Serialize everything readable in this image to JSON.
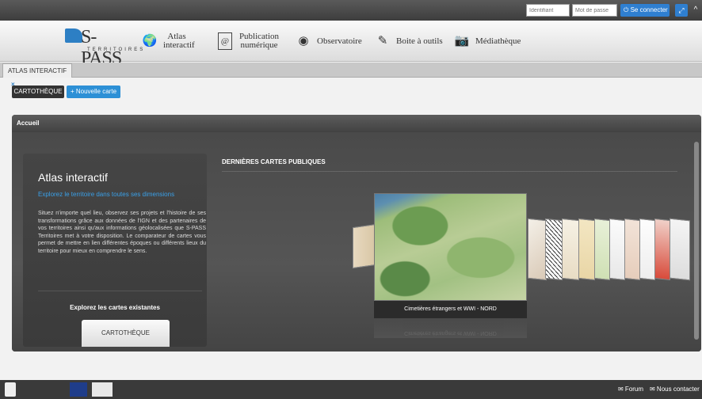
{
  "topbar": {
    "login_placeholder": "Identifiant",
    "password_placeholder": "Mot de passe",
    "connect_label": "Se connecter",
    "expand_icon": "⤢",
    "collapse_icon": "^"
  },
  "nav": {
    "logo_word": "S-PASS",
    "logo_sub": "TERRITOIRES",
    "items": [
      {
        "label": "Atlas interactif",
        "icon": "globe-icon",
        "glyph": "🌍"
      },
      {
        "label": "Publication numérique",
        "icon": "at-icon",
        "glyph": "@"
      },
      {
        "label": "Observatoire",
        "icon": "eye-icon",
        "glyph": "◉"
      },
      {
        "label": "Boite à outils",
        "icon": "tools-icon",
        "glyph": "✎"
      },
      {
        "label": "Médiathèque",
        "icon": "camera-icon",
        "glyph": "📷"
      }
    ]
  },
  "tabs": {
    "active_label": "ATLAS INTERACTIF",
    "close_glyph": "×"
  },
  "toolbar": {
    "cartotheque_label": "CARTOTHÈQUE",
    "new_map_label": "+ Nouvelle carte"
  },
  "panel": {
    "header": "Accueil",
    "card": {
      "title": "Atlas interactif",
      "subtitle": "Explorez le territoire dans toutes ses dimensions",
      "description": "Situez n'importe quel lieu, observez ses projets et l'histoire de ses transformations grâce aux données de l'IGN et des partenaires de vos territoires ainsi qu'aux informations géolocalisées que S-PASS Territoires met à votre disposition. Le comparateur de cartes vous permet de mettre en lien différentes époques ou différents lieux du territoire pour mieux en comprendre le sens.",
      "explore_label": "Explorez les cartes existantes",
      "button_label": "CARTOTHÈQUE"
    },
    "latest_title": "DERNIÈRES CARTES PUBLIQUES",
    "featured_map_caption": "Cimetières étrangers et WWI - NORD"
  },
  "colors": {
    "accent": "#2d7fc4",
    "header_dark": "#3d3d3d",
    "subtitle": "#3aa0e8"
  }
}
